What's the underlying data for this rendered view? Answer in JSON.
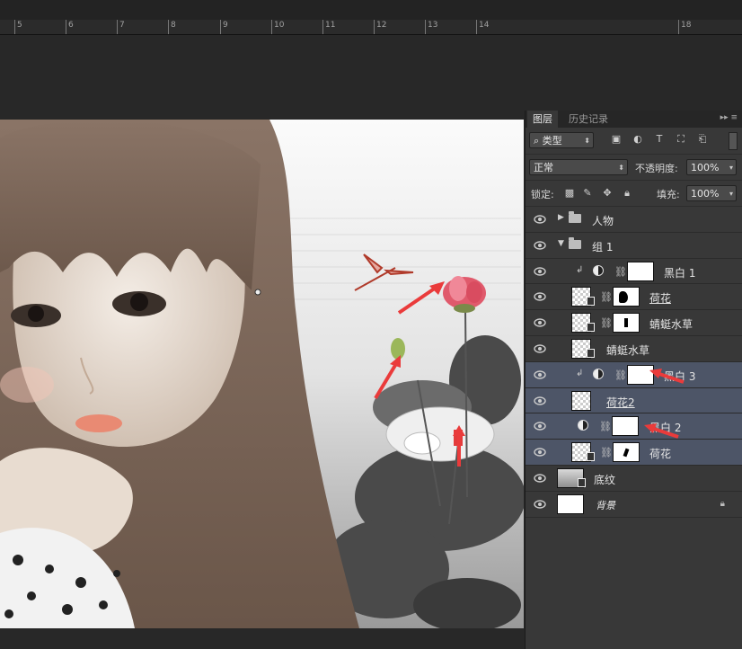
{
  "ruler": {
    "labels": [
      "5",
      "6",
      "7",
      "8",
      "9",
      "10",
      "11",
      "12",
      "13",
      "14",
      "18"
    ]
  },
  "panel": {
    "tabs": [
      "图层",
      "历史记录"
    ],
    "filter": {
      "kind_label": "类型",
      "icons": [
        "image-filter-icon",
        "adjustment-filter-icon",
        "type-filter-icon",
        "shape-filter-icon",
        "smart-filter-icon"
      ]
    },
    "blend_mode": "正常",
    "opacity_label": "不透明度:",
    "opacity_value": "100%",
    "lock_label": "锁定:",
    "fill_label": "填充:",
    "fill_value": "100%",
    "layers": [
      {
        "name": "人物",
        "type": "group",
        "collapsed": true
      },
      {
        "name": "组 1",
        "type": "group",
        "collapsed": false
      },
      {
        "name": "黑白 1",
        "type": "adjustment",
        "clipped": true
      },
      {
        "name": "荷花",
        "type": "masked",
        "underline": true
      },
      {
        "name": "蜻蜓水草",
        "type": "masked"
      },
      {
        "name": "蜻蜓水草",
        "type": "pixel"
      },
      {
        "name": "黑白 3",
        "type": "adjustment",
        "clipped": true,
        "selected": true
      },
      {
        "name": "荷花2",
        "type": "pixel",
        "underline": true,
        "selected": true
      },
      {
        "name": "黑白 2",
        "type": "adjustment",
        "selected": true
      },
      {
        "name": "荷花",
        "type": "masked",
        "selected": true
      },
      {
        "name": "底纹",
        "type": "pixel"
      },
      {
        "name": "背景",
        "type": "background",
        "italic": true
      }
    ]
  },
  "colors": {
    "panel_bg": "#383838",
    "selected_row": "#4d5567",
    "arrow_red": "#ea3b3b"
  }
}
